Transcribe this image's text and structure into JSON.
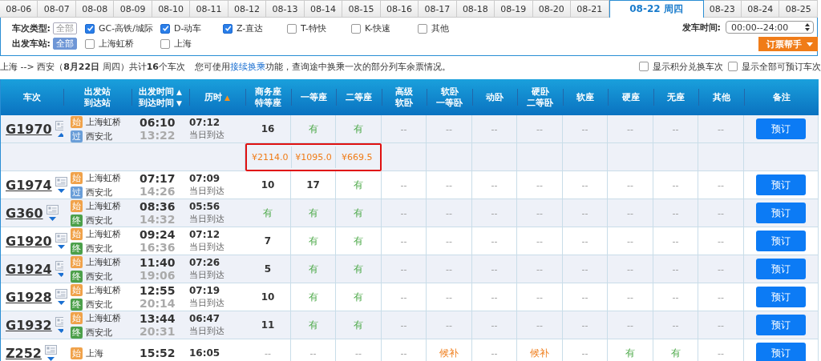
{
  "date_tabs": [
    {
      "label": "08-06",
      "selected": false
    },
    {
      "label": "08-07",
      "selected": false
    },
    {
      "label": "08-08",
      "selected": false
    },
    {
      "label": "08-09",
      "selected": false
    },
    {
      "label": "08-10",
      "selected": false
    },
    {
      "label": "08-11",
      "selected": false
    },
    {
      "label": "08-12",
      "selected": false
    },
    {
      "label": "08-13",
      "selected": false
    },
    {
      "label": "08-14",
      "selected": false
    },
    {
      "label": "08-15",
      "selected": false
    },
    {
      "label": "08-16",
      "selected": false
    },
    {
      "label": "08-17",
      "selected": false
    },
    {
      "label": "08-18",
      "selected": false
    },
    {
      "label": "08-19",
      "selected": false
    },
    {
      "label": "08-20",
      "selected": false
    },
    {
      "label": "08-21",
      "selected": false
    },
    {
      "label": "08-22",
      "weekday": "周四",
      "selected": true
    },
    {
      "label": "08-23",
      "selected": false
    },
    {
      "label": "08-24",
      "selected": false
    },
    {
      "label": "08-25",
      "selected": false
    }
  ],
  "filters": {
    "train_type": {
      "label": "车次类型:",
      "all": {
        "label": "全部",
        "selected": false
      },
      "options": [
        {
          "label": "GC-高铁/城际",
          "checked": true
        },
        {
          "label": "D-动车",
          "checked": true
        },
        {
          "label": "Z-直达",
          "checked": true
        },
        {
          "label": "T-特快",
          "checked": false
        },
        {
          "label": "K-快速",
          "checked": false
        },
        {
          "label": "其他",
          "checked": false
        }
      ]
    },
    "station": {
      "label": "出发车站:",
      "all": {
        "label": "全部",
        "selected": true
      },
      "options": [
        {
          "label": "上海虹桥",
          "checked": false
        },
        {
          "label": "上海",
          "checked": false
        }
      ]
    },
    "time": {
      "label": "发车时间:",
      "value": "00:00--24:00"
    },
    "helper_button": "订票帮手"
  },
  "summary": {
    "route": "上海 --> 西安（**8月22日**  周四）共计**16**个车次",
    "info_before": "您可使用",
    "info_link": "接续换乘",
    "info_after": "功能，查询途中换乘一次的部分列车余票情况。",
    "options": [
      {
        "label": "显示积分兑换车次",
        "checked": false
      },
      {
        "label": "显示全部可预订车次",
        "checked": false
      }
    ]
  },
  "table": {
    "columns": [
      {
        "lines": [
          "车次"
        ]
      },
      {
        "lines": [
          "出发站",
          "到达站"
        ]
      },
      {
        "lines": [
          "出发时间",
          "到达时间"
        ],
        "arrows": [
          "▲",
          "▼"
        ],
        "arrow_active": false
      },
      {
        "lines": [
          "历时"
        ],
        "arrows": [
          "▲"
        ],
        "arrow_active": true
      },
      {
        "lines": [
          "商务座",
          "特等座"
        ]
      },
      {
        "lines": [
          "一等座"
        ]
      },
      {
        "lines": [
          "二等座"
        ]
      },
      {
        "lines": [
          "高级",
          "软卧"
        ]
      },
      {
        "lines": [
          "软卧",
          "一等卧"
        ]
      },
      {
        "lines": [
          "动卧"
        ]
      },
      {
        "lines": [
          "硬卧",
          "二等卧"
        ]
      },
      {
        "lines": [
          "软座"
        ]
      },
      {
        "lines": [
          "硬座"
        ]
      },
      {
        "lines": [
          "无座"
        ]
      },
      {
        "lines": [
          "其他"
        ]
      },
      {
        "lines": [
          "备注"
        ]
      }
    ],
    "rows": [
      {
        "train": "G1970",
        "expanded": true,
        "from": {
          "badge": "始",
          "name": "上海虹桥",
          "kind": "start"
        },
        "to": {
          "badge": "过",
          "name": "西安北",
          "kind": "pass"
        },
        "depart": "06:10",
        "arrive": "13:22",
        "duration": "07:12",
        "arrival_day": "当日到达",
        "seats": [
          {
            "text": "16",
            "kind": "count"
          },
          {
            "text": "有",
            "kind": "available"
          },
          {
            "text": "有",
            "kind": "available"
          },
          {
            "text": "--",
            "kind": "none"
          },
          {
            "text": "--",
            "kind": "none"
          },
          {
            "text": "--",
            "kind": "none"
          },
          {
            "text": "--",
            "kind": "none"
          },
          {
            "text": "--",
            "kind": "none"
          },
          {
            "text": "--",
            "kind": "none"
          },
          {
            "text": "--",
            "kind": "none"
          },
          {
            "text": "--",
            "kind": "none"
          }
        ],
        "book": "预订",
        "prices": {
          "values": [
            "¥2114.0",
            "¥1095.0",
            "¥669.5"
          ],
          "highlighted": true
        }
      },
      {
        "train": "G1974",
        "expanded": false,
        "from": {
          "badge": "始",
          "name": "上海虹桥",
          "kind": "start"
        },
        "to": {
          "badge": "过",
          "name": "西安北",
          "kind": "pass"
        },
        "depart": "07:17",
        "arrive": "14:26",
        "duration": "07:09",
        "arrival_day": "当日到达",
        "seats": [
          {
            "text": "10",
            "kind": "count"
          },
          {
            "text": "17",
            "kind": "count"
          },
          {
            "text": "有",
            "kind": "available"
          },
          {
            "text": "--",
            "kind": "none"
          },
          {
            "text": "--",
            "kind": "none"
          },
          {
            "text": "--",
            "kind": "none"
          },
          {
            "text": "--",
            "kind": "none"
          },
          {
            "text": "--",
            "kind": "none"
          },
          {
            "text": "--",
            "kind": "none"
          },
          {
            "text": "--",
            "kind": "none"
          },
          {
            "text": "--",
            "kind": "none"
          }
        ],
        "book": "预订"
      },
      {
        "train": "G360",
        "expanded": false,
        "from": {
          "badge": "始",
          "name": "上海虹桥",
          "kind": "start"
        },
        "to": {
          "badge": "终",
          "name": "西安北",
          "kind": "end"
        },
        "depart": "08:36",
        "arrive": "14:32",
        "duration": "05:56",
        "arrival_day": "当日到达",
        "seats": [
          {
            "text": "有",
            "kind": "available"
          },
          {
            "text": "有",
            "kind": "available"
          },
          {
            "text": "有",
            "kind": "available"
          },
          {
            "text": "--",
            "kind": "none"
          },
          {
            "text": "--",
            "kind": "none"
          },
          {
            "text": "--",
            "kind": "none"
          },
          {
            "text": "--",
            "kind": "none"
          },
          {
            "text": "--",
            "kind": "none"
          },
          {
            "text": "--",
            "kind": "none"
          },
          {
            "text": "--",
            "kind": "none"
          },
          {
            "text": "--",
            "kind": "none"
          }
        ],
        "book": "预订"
      },
      {
        "train": "G1920",
        "expanded": false,
        "from": {
          "badge": "始",
          "name": "上海虹桥",
          "kind": "start"
        },
        "to": {
          "badge": "终",
          "name": "西安北",
          "kind": "end"
        },
        "depart": "09:24",
        "arrive": "16:36",
        "duration": "07:12",
        "arrival_day": "当日到达",
        "seats": [
          {
            "text": "7",
            "kind": "count"
          },
          {
            "text": "有",
            "kind": "available"
          },
          {
            "text": "有",
            "kind": "available"
          },
          {
            "text": "--",
            "kind": "none"
          },
          {
            "text": "--",
            "kind": "none"
          },
          {
            "text": "--",
            "kind": "none"
          },
          {
            "text": "--",
            "kind": "none"
          },
          {
            "text": "--",
            "kind": "none"
          },
          {
            "text": "--",
            "kind": "none"
          },
          {
            "text": "--",
            "kind": "none"
          },
          {
            "text": "--",
            "kind": "none"
          }
        ],
        "book": "预订"
      },
      {
        "train": "G1924",
        "expanded": false,
        "from": {
          "badge": "始",
          "name": "上海虹桥",
          "kind": "start"
        },
        "to": {
          "badge": "终",
          "name": "西安北",
          "kind": "end"
        },
        "depart": "11:40",
        "arrive": "19:06",
        "duration": "07:26",
        "arrival_day": "当日到达",
        "seats": [
          {
            "text": "5",
            "kind": "count"
          },
          {
            "text": "有",
            "kind": "available"
          },
          {
            "text": "有",
            "kind": "available"
          },
          {
            "text": "--",
            "kind": "none"
          },
          {
            "text": "--",
            "kind": "none"
          },
          {
            "text": "--",
            "kind": "none"
          },
          {
            "text": "--",
            "kind": "none"
          },
          {
            "text": "--",
            "kind": "none"
          },
          {
            "text": "--",
            "kind": "none"
          },
          {
            "text": "--",
            "kind": "none"
          },
          {
            "text": "--",
            "kind": "none"
          }
        ],
        "book": "预订"
      },
      {
        "train": "G1928",
        "expanded": false,
        "from": {
          "badge": "始",
          "name": "上海虹桥",
          "kind": "start"
        },
        "to": {
          "badge": "终",
          "name": "西安北",
          "kind": "end"
        },
        "depart": "12:55",
        "arrive": "20:14",
        "duration": "07:19",
        "arrival_day": "当日到达",
        "seats": [
          {
            "text": "10",
            "kind": "count"
          },
          {
            "text": "有",
            "kind": "available"
          },
          {
            "text": "有",
            "kind": "available"
          },
          {
            "text": "--",
            "kind": "none"
          },
          {
            "text": "--",
            "kind": "none"
          },
          {
            "text": "--",
            "kind": "none"
          },
          {
            "text": "--",
            "kind": "none"
          },
          {
            "text": "--",
            "kind": "none"
          },
          {
            "text": "--",
            "kind": "none"
          },
          {
            "text": "--",
            "kind": "none"
          },
          {
            "text": "--",
            "kind": "none"
          }
        ],
        "book": "预订"
      },
      {
        "train": "G1932",
        "expanded": false,
        "from": {
          "badge": "始",
          "name": "上海虹桥",
          "kind": "start"
        },
        "to": {
          "badge": "终",
          "name": "西安北",
          "kind": "end"
        },
        "depart": "13:44",
        "arrive": "20:31",
        "duration": "06:47",
        "arrival_day": "当日到达",
        "seats": [
          {
            "text": "11",
            "kind": "count"
          },
          {
            "text": "有",
            "kind": "available"
          },
          {
            "text": "有",
            "kind": "available"
          },
          {
            "text": "--",
            "kind": "none"
          },
          {
            "text": "--",
            "kind": "none"
          },
          {
            "text": "--",
            "kind": "none"
          },
          {
            "text": "--",
            "kind": "none"
          },
          {
            "text": "--",
            "kind": "none"
          },
          {
            "text": "--",
            "kind": "none"
          },
          {
            "text": "--",
            "kind": "none"
          },
          {
            "text": "--",
            "kind": "none"
          }
        ],
        "book": "预订"
      },
      {
        "train": "Z252",
        "expanded": false,
        "from": {
          "badge": "始",
          "name": "上海",
          "kind": "start"
        },
        "depart": "15:52",
        "duration": "16:05",
        "seats": [
          {
            "text": "--",
            "kind": "none"
          },
          {
            "text": "--",
            "kind": "none"
          },
          {
            "text": "--",
            "kind": "none"
          },
          {
            "text": "--",
            "kind": "none"
          },
          {
            "text": "候补",
            "kind": "waitlist"
          },
          {
            "text": "--",
            "kind": "none"
          },
          {
            "text": "候补",
            "kind": "waitlist"
          },
          {
            "text": "--",
            "kind": "none"
          },
          {
            "text": "有",
            "kind": "available"
          },
          {
            "text": "有",
            "kind": "available"
          },
          {
            "text": "--",
            "kind": "none"
          }
        ],
        "book": "预订"
      }
    ]
  }
}
